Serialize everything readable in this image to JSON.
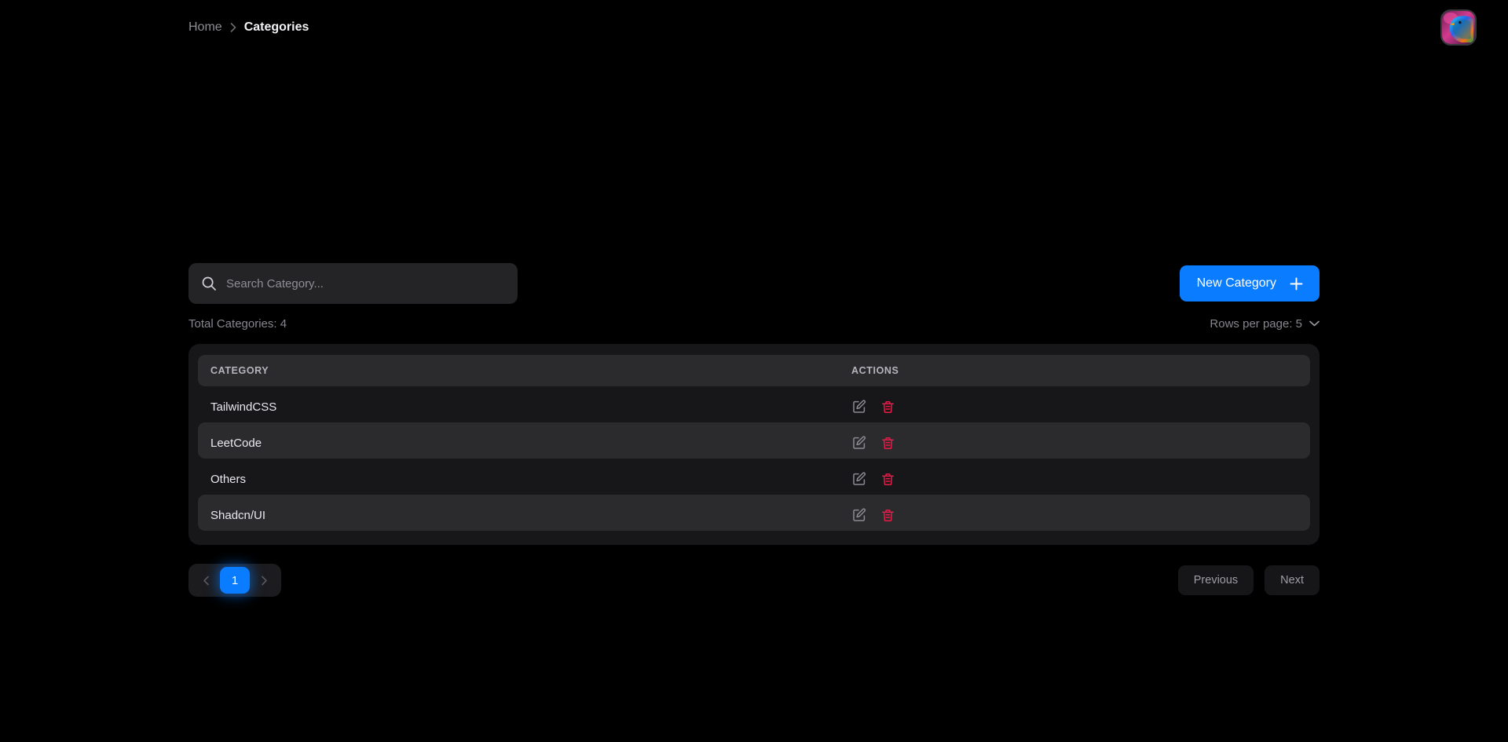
{
  "breadcrumb": {
    "home_label": "Home",
    "separator": "›",
    "current_label": "Categories"
  },
  "avatar": {
    "icon": "user-avatar-bird-image"
  },
  "search": {
    "placeholder": "Search Category...",
    "value": "",
    "icon": "search-icon"
  },
  "toolbar": {
    "new_category_label": "New Category",
    "plus_icon": "plus-icon"
  },
  "meta": {
    "total_text": "Total Categories: 4",
    "rows_per_page_label": "Rows per page: 5",
    "rows_per_page_value": "5",
    "chevron_icon": "chevron-down-icon"
  },
  "table": {
    "columns": [
      "CATEGORY",
      "ACTIONS"
    ],
    "rows": [
      {
        "category": "TailwindCSS"
      },
      {
        "category": "LeetCode"
      },
      {
        "category": "Others"
      },
      {
        "category": "Shadcn/UI"
      }
    ],
    "row_actions": {
      "edit_icon": "edit-pencil-icon",
      "delete_icon": "trash-icon"
    }
  },
  "pagination": {
    "prev_arrow_icon": "chevron-left-icon",
    "next_arrow_icon": "chevron-right-icon",
    "current_page": "1",
    "previous_label": "Previous",
    "next_label": "Next"
  },
  "colors": {
    "accent_blue": "#0a7cff",
    "delete_red": "#e11d48",
    "page_background": "#000000",
    "card_background": "#171719",
    "row_alt_background": "#2b2b2e"
  }
}
